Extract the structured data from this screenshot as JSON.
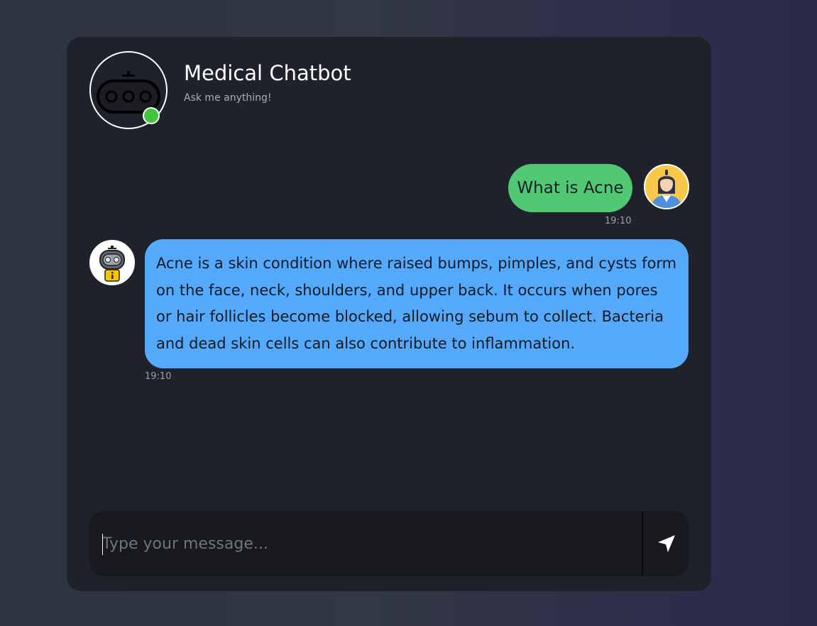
{
  "header": {
    "title": "Medical Chatbot",
    "subtitle": "Ask me anything!",
    "status": "online",
    "status_color": "#44c63c",
    "avatar_icon": "robot-icon"
  },
  "messages": [
    {
      "sender": "user",
      "text": "What is Acne",
      "time": "19:10",
      "bubble_color": "#52c874",
      "avatar_icon": "user-avatar-icon"
    },
    {
      "sender": "bot",
      "text": "Acne is a skin condition where raised bumps, pimples, and cysts form on the face, neck, shoulders, and upper back. It occurs when pores or hair follicles become blocked, allowing sebum to collect. Bacteria and dead skin cells can also contribute to inflammation.",
      "time": "19:10",
      "bubble_color": "#54a9fb",
      "avatar_icon": "bot-avatar-icon"
    }
  ],
  "composer": {
    "placeholder": "Type your message...",
    "value": "",
    "send_icon": "send-icon"
  }
}
